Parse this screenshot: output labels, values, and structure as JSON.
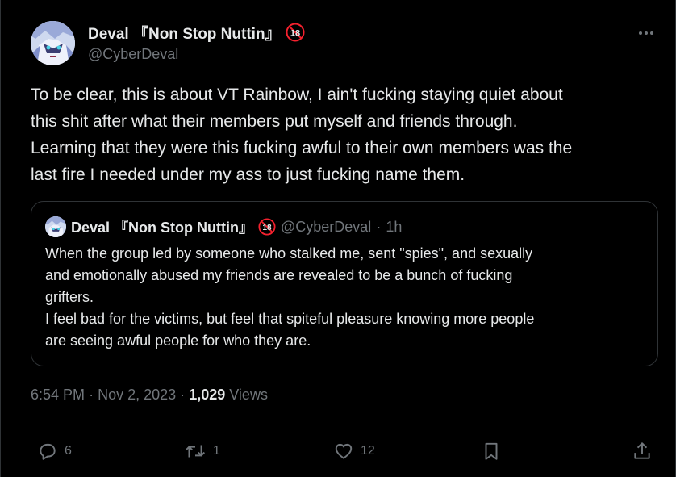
{
  "tweet": {
    "author": {
      "display_name": "Deval 『Non Stop Nuttin』",
      "handle": "@CyberDeval",
      "badge_text": "18"
    },
    "more_icon": "more-horizontal-icon",
    "text_lines": [
      "To be clear, this is about VT Rainbow, I ain't fucking staying quiet about",
      "this shit after what their members put myself and friends through.",
      "Learning that they were this fucking awful to their own members was the",
      "last fire I needed under my ass to just fucking name them."
    ],
    "quote": {
      "display_name": "Deval 『Non Stop Nuttin』",
      "badge_text": "18",
      "handle": "@CyberDeval",
      "separator": "·",
      "time": "1h",
      "text_lines": [
        "When the group led by someone who stalked me, sent \"spies\", and sexually",
        "and emotionally abused my friends are revealed to be a bunch of fucking",
        "grifters.",
        "I feel bad for the victims, but feel that spiteful pleasure knowing more people",
        "are seeing awful people for who they are."
      ]
    },
    "meta": {
      "time": "6:54 PM",
      "sep1": "·",
      "date": "Nov 2, 2023",
      "sep2": "·",
      "views_count": "1,029",
      "views_label": "Views"
    },
    "actions": {
      "reply_count": "6",
      "retweet_count": "1",
      "like_count": "12"
    },
    "colors": {
      "background": "#000000",
      "text": "#e7e9ea",
      "secondary": "#71767b",
      "border": "#2f3336",
      "badge": "#f4212e"
    }
  }
}
